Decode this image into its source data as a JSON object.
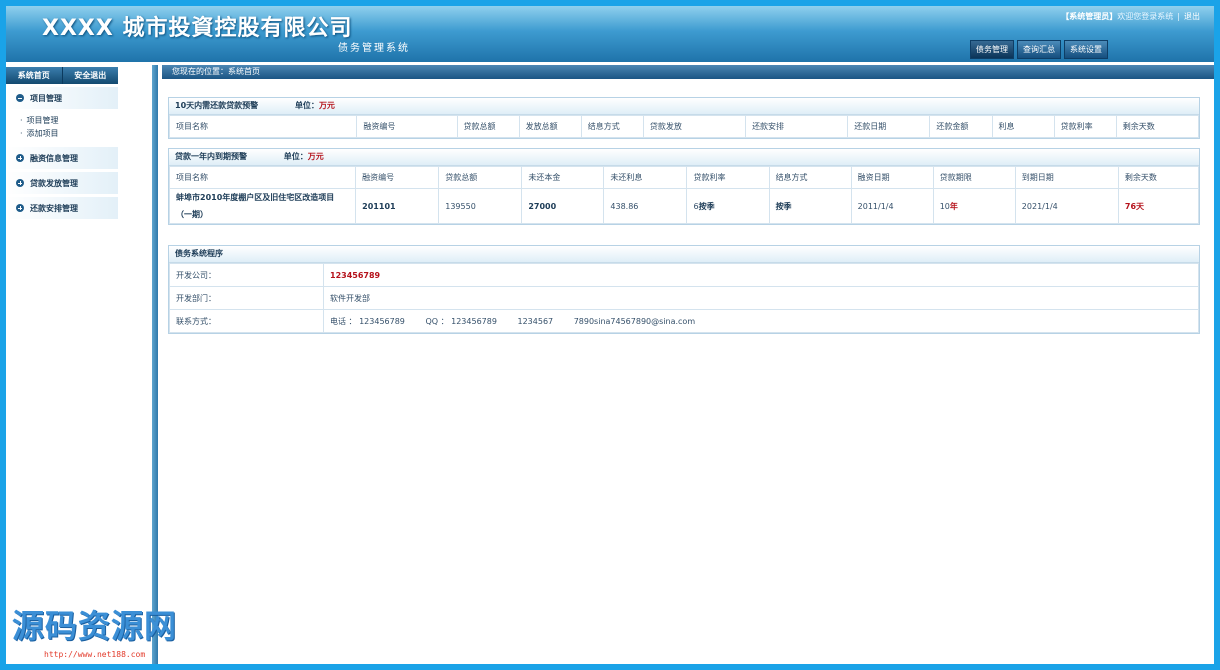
{
  "header": {
    "company": "XXXX 城市投資控股有限公司",
    "subtitle": "债务管理系统",
    "role": "【系统管理员】",
    "welcome": "欢迎您登录系统",
    "logout": "退出",
    "tabs": [
      "债务管理",
      "查询汇总",
      "系统设置"
    ]
  },
  "sidebar": {
    "top_buttons": [
      "系统首页",
      "安全退出"
    ],
    "groups": [
      {
        "label": "项目管理",
        "expanded": true,
        "items": [
          "项目管理",
          "添加项目"
        ]
      },
      {
        "label": "融资信息管理",
        "expanded": false
      },
      {
        "label": "贷款发放管理",
        "expanded": false
      },
      {
        "label": "还款安排管理",
        "expanded": false
      }
    ]
  },
  "breadcrumb": {
    "prefix": "您现在的位置：",
    "page": "系统首页"
  },
  "panel1": {
    "title": "10天内需还款贷款预警",
    "unit_label": "单位：",
    "unit": "万元",
    "columns": [
      "项目名称",
      "融资编号",
      "贷款总额",
      "发放总额",
      "结息方式",
      "贷款发放",
      "还款安排",
      "还款日期",
      "还款金额",
      "利息",
      "贷款利率",
      "剩余天数"
    ]
  },
  "panel2": {
    "title": "贷款一年内到期预警",
    "unit_label": "单位：",
    "unit": "万元",
    "columns": [
      "项目名称",
      "融资编号",
      "贷款总额",
      "未还本金",
      "未还利息",
      "贷款利率",
      "结息方式",
      "融资日期",
      "贷款期限",
      "到期日期",
      "剩余天数"
    ],
    "row": {
      "name": "蚌埠市2010年度棚户区及旧住宅区改造项目（一期）",
      "code": "201101",
      "total": "139550",
      "principal": "27000",
      "interest": "438.86",
      "rate_num": "6",
      "rate_unit": "按季",
      "method": "按季",
      "date": "2011/1/4",
      "term_num": "10",
      "term_unit": "年",
      "due": "2021/1/4",
      "days": "76天"
    }
  },
  "panel3": {
    "title": "债务系统程序",
    "company_label": "开发公司：",
    "company_value": "123456789",
    "dept_label": "开发部门：",
    "dept_value": "软件开发部",
    "contact_label": "联系方式：",
    "phone": "电话 ： 123456789",
    "qq": "QQ ： 123456789",
    "extra": "1234567",
    "email": "7890sina74567890@sina.com"
  },
  "watermark": {
    "text": "源码资源网",
    "url": "http://www.net188.com"
  }
}
